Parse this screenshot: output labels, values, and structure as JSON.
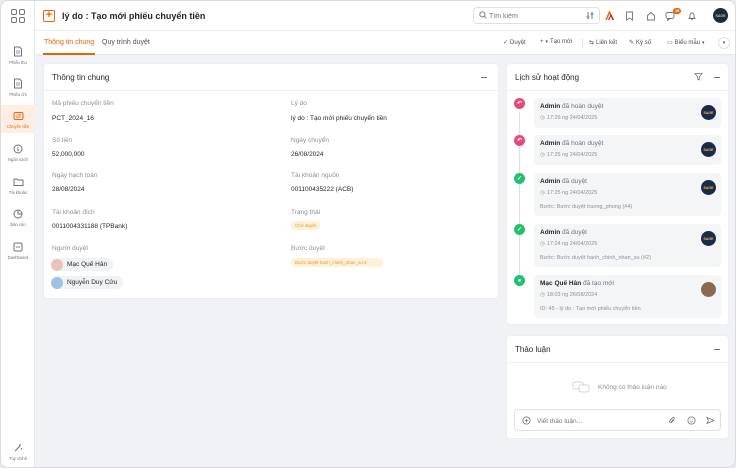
{
  "app": {
    "title": "lý do : Tạo mới phiếu chuyển tiền",
    "search_placeholder": "Tìm kiếm",
    "notification_count": "16",
    "user_avatar_text": "SAGE"
  },
  "sidebar": {
    "items": [
      {
        "label": "Phiếu thu"
      },
      {
        "label": "Phiếu chi"
      },
      {
        "label": "Chuyển tiền"
      },
      {
        "label": "Ngân sách"
      },
      {
        "label": "Tài khoản"
      },
      {
        "label": "Báo cáo"
      },
      {
        "label": "Dashboard"
      }
    ],
    "bottom_label": "Tùy chỉnh"
  },
  "tabs": [
    {
      "label": "Thông tin chung"
    },
    {
      "label": "Quy trình duyệt"
    }
  ],
  "actions": {
    "approve": "Duyệt",
    "create": "Tạo mới",
    "link": "Liên kết",
    "sign": "Ký số",
    "template": "Biểu mẫu"
  },
  "general_info": {
    "title": "Thông tin chung",
    "fields": [
      {
        "label": "Mã phiếu chuyển tiền",
        "value": "PCT_2024_16"
      },
      {
        "label": "Lý do",
        "value": "lý do : Tạo mới phiếu chuyển tiền"
      },
      {
        "label": "Số tiền",
        "value": "52,000,000"
      },
      {
        "label": "Ngày chuyển",
        "value": "26/08/2024"
      },
      {
        "label": "Ngày hạch toán",
        "value": "28/08/2024"
      },
      {
        "label": "Tài khoản nguồn",
        "value": "001100435222 (ACB)"
      },
      {
        "label": "Tài khoản đích",
        "value": "0011004331188 (TPBank)"
      },
      {
        "label": "Trạng thái",
        "value": "Chờ duyệt"
      },
      {
        "label": "Người duyệt",
        "value": ""
      },
      {
        "label": "Bước duyệt",
        "value": "Bước duyệt hanh_chinh_nhan_su 5"
      }
    ],
    "approvers": [
      "Mạc Quế Hân",
      "Nguyễn Duy Cửu"
    ]
  },
  "activity": {
    "title": "Lịch sử hoạt động",
    "items": [
      {
        "user": "Admin",
        "action": "đã hoàn duyệt",
        "time": "17:26 ng 24/04/2025",
        "note": ""
      },
      {
        "user": "Admin",
        "action": "đã hoàn duyệt",
        "time": "17:25 ng 24/04/2025",
        "note": ""
      },
      {
        "user": "Admin",
        "action": "đã duyệt",
        "time": "17:25 ng 24/04/2025",
        "note": "Bước: Bước duyệt truong_phong (#4)"
      },
      {
        "user": "Admin",
        "action": "đã duyệt",
        "time": "17:24 ng 24/04/2025",
        "note": "Bước: Bước duyệt hanh_chinh_nhan_su (#2)"
      },
      {
        "user": "Mạc Quế Hân",
        "action": "đã tạo mới",
        "time": "18:03 ng 26/08/2024",
        "note": "ID: 45 - lý do : Tạo mới phiếu chuyển tiền"
      }
    ]
  },
  "discussion": {
    "title": "Thảo luận",
    "empty": "Không có thảo luận nào",
    "placeholder": "Viết thảo luận..."
  },
  "colors": {
    "accent": "#e8630a",
    "revert": "#e8477a",
    "approved": "#23c16b"
  }
}
